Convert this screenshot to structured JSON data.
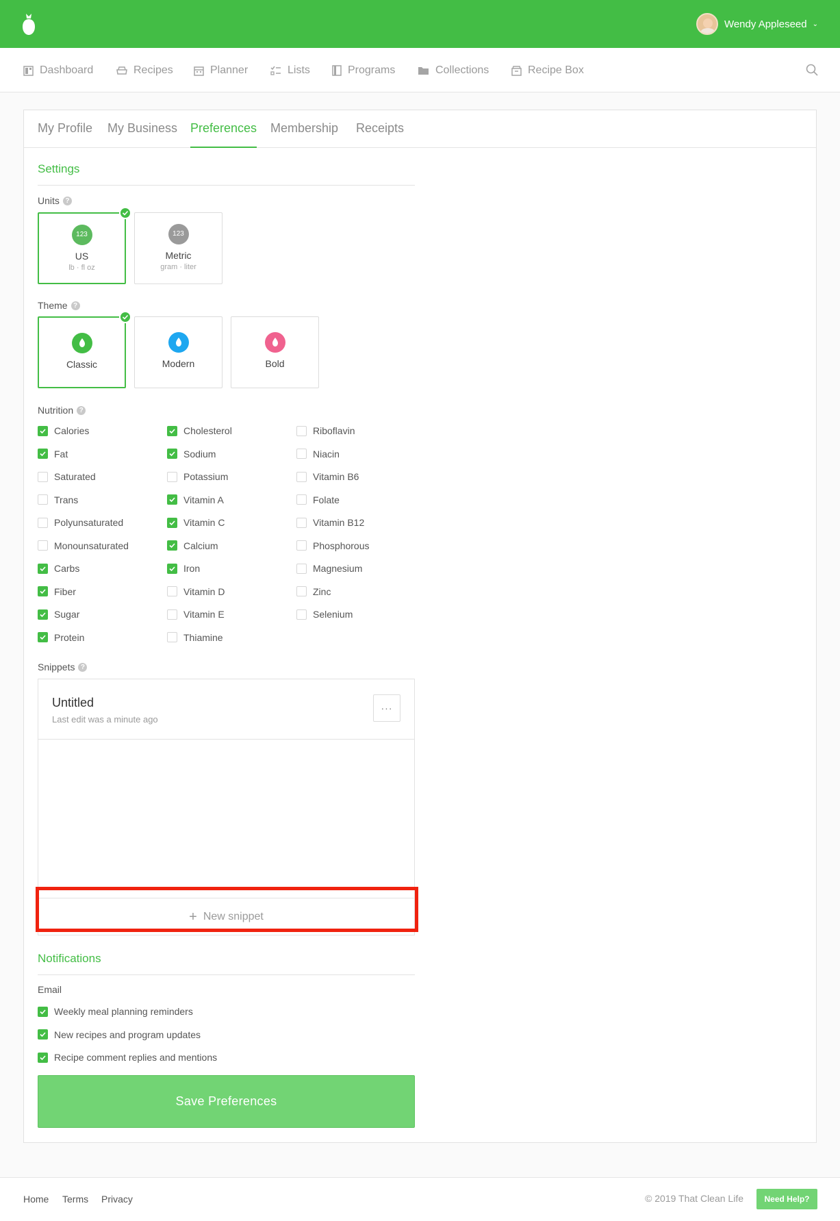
{
  "user": {
    "name": "Wendy Appleseed"
  },
  "nav": {
    "items": [
      {
        "label": "Dashboard",
        "icon": "dashboard-icon"
      },
      {
        "label": "Recipes",
        "icon": "recipes-icon"
      },
      {
        "label": "Planner",
        "icon": "planner-icon"
      },
      {
        "label": "Lists",
        "icon": "lists-icon"
      },
      {
        "label": "Programs",
        "icon": "programs-icon"
      },
      {
        "label": "Collections",
        "icon": "collections-icon"
      },
      {
        "label": "Recipe Box",
        "icon": "recipe-box-icon"
      }
    ]
  },
  "tabs": [
    "My Profile",
    "My Business",
    "Preferences",
    "Membership",
    "Receipts"
  ],
  "active_tab": "Preferences",
  "settings": {
    "title": "Settings",
    "units": {
      "label": "Units",
      "options": [
        {
          "badge": "123",
          "name": "US",
          "sub": "lb · fl oz",
          "selected": true
        },
        {
          "badge": "123",
          "name": "Metric",
          "sub": "gram · liter",
          "selected": false
        }
      ]
    },
    "theme": {
      "label": "Theme",
      "options": [
        {
          "name": "Classic",
          "color": "#43bd45",
          "selected": true
        },
        {
          "name": "Modern",
          "color": "#1ea7f0",
          "selected": false
        },
        {
          "name": "Bold",
          "color": "#f0628f",
          "selected": false
        }
      ]
    },
    "nutrition": {
      "label": "Nutrition",
      "columns": [
        [
          {
            "label": "Calories",
            "checked": true
          },
          {
            "label": "Fat",
            "checked": true
          },
          {
            "label": "Saturated",
            "checked": false
          },
          {
            "label": "Trans",
            "checked": false
          },
          {
            "label": "Polyunsaturated",
            "checked": false
          },
          {
            "label": "Monounsaturated",
            "checked": false
          },
          {
            "label": "Carbs",
            "checked": true
          },
          {
            "label": "Fiber",
            "checked": true
          },
          {
            "label": "Sugar",
            "checked": true
          },
          {
            "label": "Protein",
            "checked": true
          }
        ],
        [
          {
            "label": "Cholesterol",
            "checked": true
          },
          {
            "label": "Sodium",
            "checked": true
          },
          {
            "label": "Potassium",
            "checked": false
          },
          {
            "label": "Vitamin A",
            "checked": true
          },
          {
            "label": "Vitamin C",
            "checked": true
          },
          {
            "label": "Calcium",
            "checked": true
          },
          {
            "label": "Iron",
            "checked": true
          },
          {
            "label": "Vitamin D",
            "checked": false
          },
          {
            "label": "Vitamin E",
            "checked": false
          },
          {
            "label": "Thiamine",
            "checked": false
          }
        ],
        [
          {
            "label": "Riboflavin",
            "checked": false
          },
          {
            "label": "Niacin",
            "checked": false
          },
          {
            "label": "Vitamin B6",
            "checked": false
          },
          {
            "label": "Folate",
            "checked": false
          },
          {
            "label": "Vitamin B12",
            "checked": false
          },
          {
            "label": "Phosphorous",
            "checked": false
          },
          {
            "label": "Magnesium",
            "checked": false
          },
          {
            "label": "Zinc",
            "checked": false
          },
          {
            "label": "Selenium",
            "checked": false
          }
        ]
      ]
    },
    "snippets": {
      "label": "Snippets",
      "items": [
        {
          "title": "Untitled",
          "subtitle": "Last edit was a minute ago",
          "menu": "···"
        }
      ],
      "new_label": "New snippet"
    }
  },
  "notifications": {
    "title": "Notifications",
    "email_label": "Email",
    "items": [
      {
        "label": "Weekly meal planning reminders",
        "checked": true
      },
      {
        "label": "New recipes and program updates",
        "checked": true
      },
      {
        "label": "Recipe comment replies and mentions",
        "checked": true
      }
    ]
  },
  "save_label": "Save Preferences",
  "footer": {
    "links": [
      "Home",
      "Terms",
      "Privacy"
    ],
    "copyright": "© 2019 That Clean Life",
    "help_label": "Need Help?"
  },
  "colors": {
    "brand": "#43bd45",
    "button": "#72d474",
    "highlight": "#f0220f"
  }
}
